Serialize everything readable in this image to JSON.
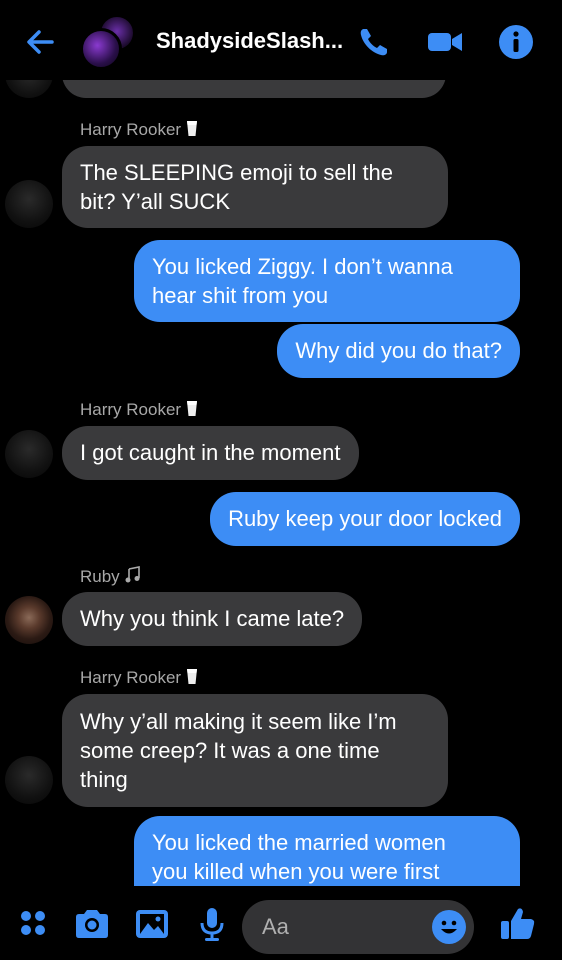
{
  "header": {
    "title": "ShadysideSlash...",
    "accent": "#3d8df5"
  },
  "messages": [
    {
      "type": "name",
      "sender": "Harry Rooker",
      "badge_icon": "milk-glass-icon"
    },
    {
      "type": "in",
      "sender": "Harry Rooker",
      "lines": [
        "The SLEEPING emoji to sell the",
        "bit? Y’all SUCK"
      ]
    },
    {
      "type": "out",
      "lines": [
        "You licked Ziggy. I don’t wanna",
        "hear shit from you"
      ]
    },
    {
      "type": "out",
      "lines": [
        "Why did you do that?"
      ]
    },
    {
      "type": "name",
      "sender": "Harry Rooker",
      "badge_icon": "milk-glass-icon"
    },
    {
      "type": "in",
      "sender": "Harry Rooker",
      "lines": [
        "I got caught in the moment"
      ]
    },
    {
      "type": "out",
      "lines": [
        "Ruby keep your door locked"
      ]
    },
    {
      "type": "name",
      "sender": "Ruby",
      "badge_icon": "music-notes-icon"
    },
    {
      "type": "in",
      "sender": "Ruby",
      "lines": [
        "Why you think I came late?"
      ]
    },
    {
      "type": "name",
      "sender": "Harry Rooker",
      "badge_icon": "milk-glass-icon"
    },
    {
      "type": "in",
      "sender": "Harry Rooker",
      "lines": [
        "Why y’all making it seem like I’m",
        "some creep? It was a one time",
        "thing"
      ]
    },
    {
      "type": "out",
      "lines": [
        "You licked the married women",
        "you killed when you were first"
      ]
    }
  ],
  "composer": {
    "placeholder": "Aa"
  },
  "toolbar_icons": [
    "menu-dots-icon",
    "camera-icon",
    "gallery-icon",
    "microphone-icon",
    "emoji-icon",
    "thumbs-up-icon"
  ]
}
